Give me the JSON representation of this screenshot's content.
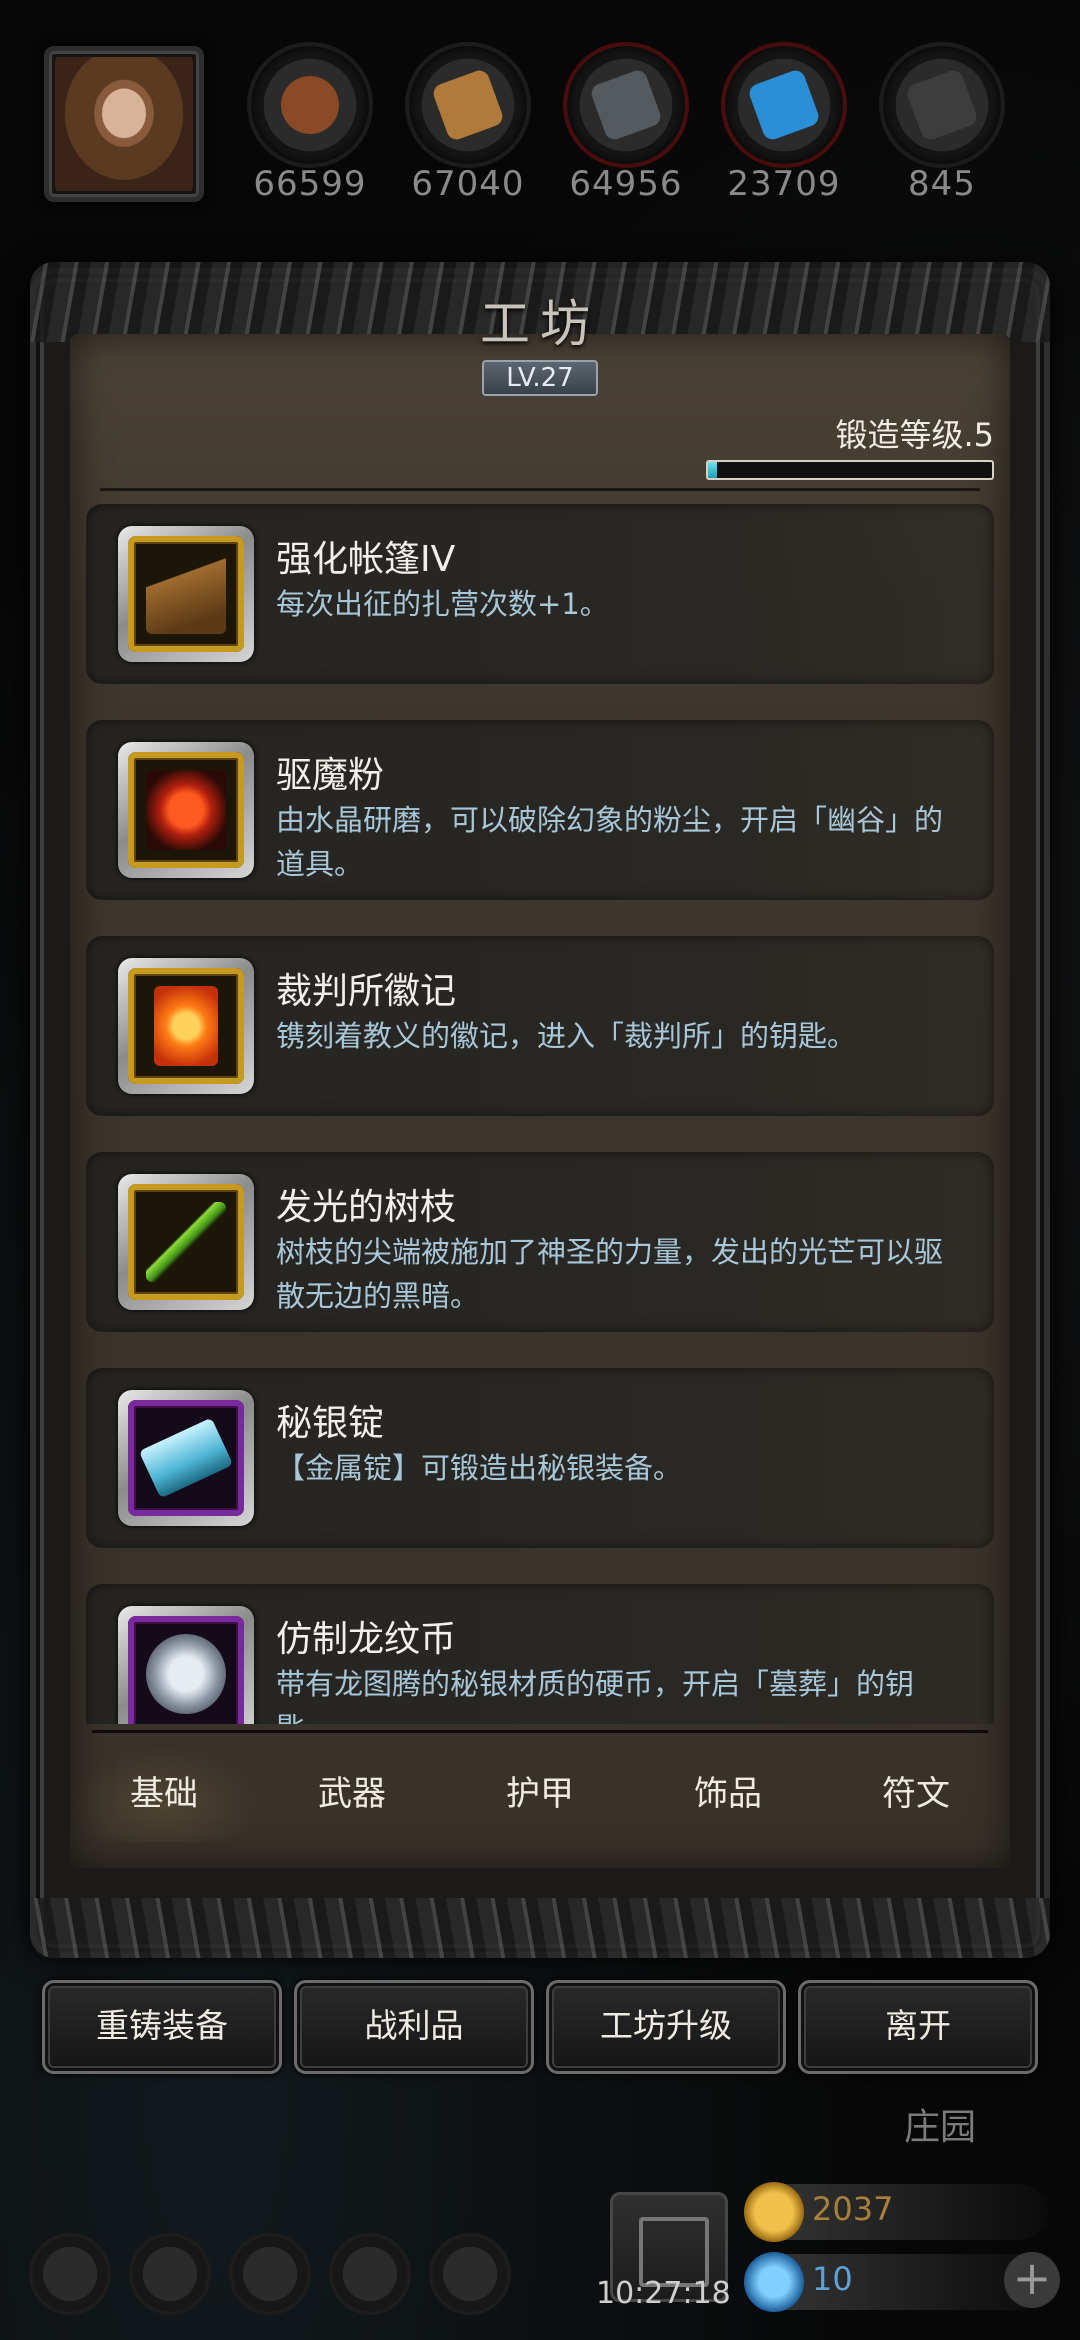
{
  "resources": [
    {
      "name": "wood-log-icon",
      "value": "66599",
      "color": "#8a4a25"
    },
    {
      "name": "plank-icon",
      "value": "67040",
      "color": "#b07a3a"
    },
    {
      "name": "iron-ingot-icon",
      "value": "64956",
      "color": "#555a5f"
    },
    {
      "name": "crystal-icon",
      "value": "23709",
      "color": "#2a8fd6"
    },
    {
      "name": "dark-ingot-icon",
      "value": "845",
      "color": "#3d3d3d"
    }
  ],
  "panel": {
    "title": "工坊",
    "level": "LV.27",
    "forge_label": "锻造等级.5",
    "forge_progress": 0.03
  },
  "items": [
    {
      "name": "强化帐篷IV",
      "desc": "每次出征的扎营次数+1。",
      "icon": "tent-icon",
      "frame": "gold"
    },
    {
      "name": "驱魔粉",
      "desc": "由水晶研磨，可以破除幻象的粉尘，开启「幽谷」的道具。",
      "icon": "red-powder-icon",
      "frame": "gold"
    },
    {
      "name": "裁判所徽记",
      "desc": "镌刻着教义的徽记，进入「裁判所」的钥匙。",
      "icon": "emblem-icon",
      "frame": "gold"
    },
    {
      "name": "发光的树枝",
      "desc": "树枝的尖端被施加了神圣的力量，发出的光芒可以驱散无边的黑暗。",
      "icon": "glowing-branch-icon",
      "frame": "gold"
    },
    {
      "name": "秘银锭",
      "desc": "【金属锭】可锻造出秘银装备。",
      "icon": "mithril-ingot-icon",
      "frame": "purple"
    },
    {
      "name": "仿制龙纹币",
      "desc": "带有龙图腾的秘银材质的硬币，开启「墓葬」的钥匙。",
      "icon": "dragon-coin-icon",
      "frame": "purple"
    }
  ],
  "tabs": [
    "基础",
    "武器",
    "护甲",
    "饰品",
    "符文"
  ],
  "actions": [
    "重铸装备",
    "战利品",
    "工坊升级",
    "离开"
  ],
  "estate": "庄园",
  "clock": "10:27:18",
  "gold": "2037",
  "gems": "10"
}
